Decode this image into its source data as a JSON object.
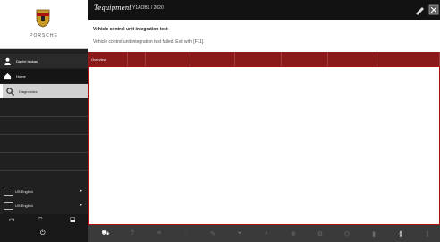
{
  "brand": {
    "name": "PORSCHE"
  },
  "sidebar": {
    "user": {
      "label": "Daniel Isukas"
    },
    "items": [
      {
        "label": "Home"
      },
      {
        "label": "Diagnostics"
      }
    ],
    "languages": [
      {
        "label": "US English"
      },
      {
        "label": "US English"
      }
    ]
  },
  "header": {
    "app_name": "Tequipment",
    "vehicle": "Y1AOB1 / 2020"
  },
  "message": {
    "title": "Vehicle control unit integration test",
    "text": "Vehicle control unit integration test failed. Exit with [F11]."
  },
  "tabs": [
    {
      "label": "Overview"
    },
    {
      "label": ""
    },
    {
      "label": ""
    },
    {
      "label": ""
    },
    {
      "label": ""
    },
    {
      "label": ""
    },
    {
      "label": ""
    },
    {
      "label": ""
    }
  ],
  "toolbar": {
    "icons": [
      "car-icon",
      "question-icon",
      "list-icon",
      "signal-icon",
      "edit-icon",
      "filter-icon",
      "search-icon",
      "zoom-icon",
      "settings-icon",
      "network-icon",
      "delete-icon",
      "back-icon",
      "forward-icon"
    ],
    "active_index": 0
  },
  "colors": {
    "accent": "#8a1a1a",
    "sidebar": "#202020"
  }
}
